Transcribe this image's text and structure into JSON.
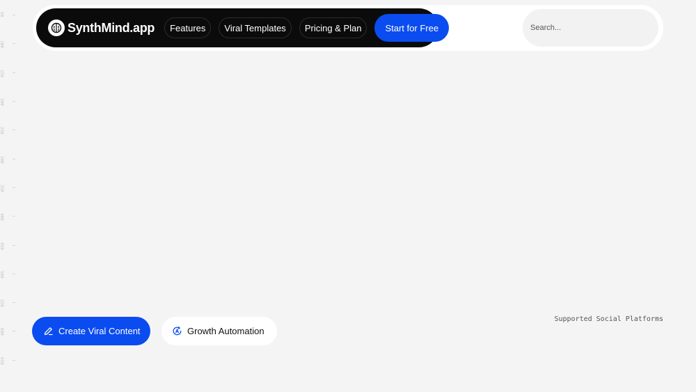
{
  "ruler": {
    "marks": [
      "50",
      "100",
      "150",
      "200",
      "250",
      "300",
      "350",
      "400",
      "450",
      "500",
      "550",
      "600",
      "650"
    ]
  },
  "header": {
    "brand": "SynthMind.app",
    "brand_icon": "brain-icon",
    "nav": [
      {
        "label": "Features"
      },
      {
        "label": "Viral Templates"
      },
      {
        "label": "Pricing & Plan"
      }
    ],
    "cta_label": "Start for Free",
    "search": {
      "placeholder": "Search...",
      "value": ""
    }
  },
  "hero": {
    "primary_button": {
      "label": "Create Viral Content",
      "icon": "pencil-icon"
    },
    "secondary_button": {
      "label": "Growth Automation",
      "icon": "automation-icon"
    },
    "platforms_label": "Supported Social Platforms"
  },
  "colors": {
    "accent": "#0a4cf0",
    "nav_background": "#0b0b0b",
    "page_background": "#f4f4f4"
  }
}
